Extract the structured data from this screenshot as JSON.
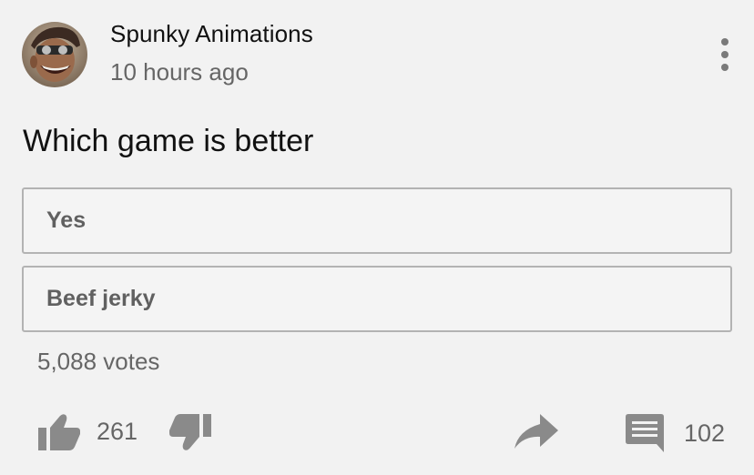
{
  "post": {
    "author": "Spunky Animations",
    "time": "10 hours ago",
    "question": "Which game is better",
    "options": [
      {
        "label": "Yes"
      },
      {
        "label": "Beef jerky"
      }
    ],
    "votes": "5,088 votes"
  },
  "actions": {
    "likes": "261",
    "comments": "102"
  },
  "icons": {
    "like": "thumbs-up-icon",
    "dislike": "thumbs-down-icon",
    "share": "share-arrow-icon",
    "comment": "comment-icon",
    "menu": "more-vertical-icon"
  },
  "colors": {
    "background": "#f2f2f2",
    "icon": "#8a8a8a",
    "border": "#b3b3b3"
  }
}
